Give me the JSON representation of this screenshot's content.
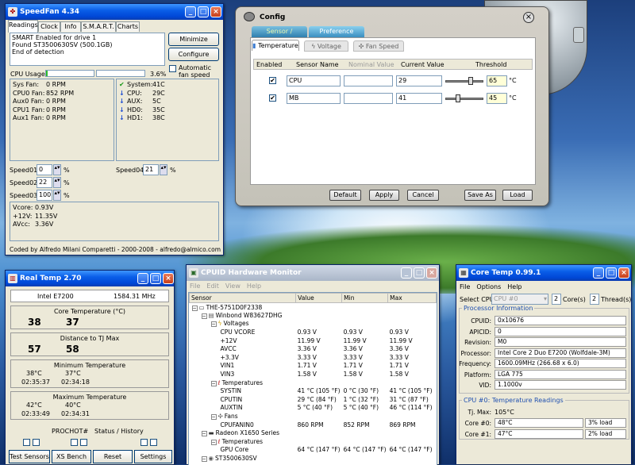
{
  "speedfan": {
    "title": "SpeedFan 4.34",
    "tabs": [
      "Readings",
      "Clock",
      "Info",
      "S.M.A.R.T.",
      "Charts"
    ],
    "log": [
      "SMART Enabled for drive 1",
      "Found ST3500630SV (500.1GB)",
      "End of detection"
    ],
    "minimize": "Minimize",
    "configure": "Configure",
    "cpu_usage_label": "CPU Usage",
    "cpu_usage_value": "3.6%",
    "cpu_usage_fraction": 0.036,
    "auto_fan": "Automatic fan speed",
    "fans": [
      {
        "label": "Sys Fan:",
        "value": "0 RPM"
      },
      {
        "label": "CPU0 Fan:",
        "value": "852 RPM"
      },
      {
        "label": "Aux0 Fan:",
        "value": "0 RPM"
      },
      {
        "label": "CPU1 Fan:",
        "value": "0 RPM"
      },
      {
        "label": "Aux1 Fan:",
        "value": "0 RPM"
      }
    ],
    "temps": [
      {
        "label": "System:",
        "value": "41C",
        "icon": "check"
      },
      {
        "label": "CPU:",
        "value": "29C",
        "icon": "down"
      },
      {
        "label": "AUX:",
        "value": "5C",
        "icon": "down"
      },
      {
        "label": "HD0:",
        "value": "35C",
        "icon": "down"
      },
      {
        "label": "HD1:",
        "value": "38C",
        "icon": "down"
      }
    ],
    "speeds": [
      {
        "label": "Speed01:",
        "value": "0",
        "unit": "%"
      },
      {
        "label": "Speed02:",
        "value": "22",
        "unit": "%"
      },
      {
        "label": "Speed03:",
        "value": "100",
        "unit": "%"
      },
      {
        "label": "Speed04:",
        "value": "21",
        "unit": "%"
      }
    ],
    "volts": [
      {
        "label": "Vcore:",
        "value": "0.93V"
      },
      {
        "label": "+12V:",
        "value": "11.35V"
      },
      {
        "label": "AVcc:",
        "value": "3.36V"
      }
    ],
    "footer": "Coded by Alfredo Milani Comparetti - 2000-2008 - alfredo@almico.com"
  },
  "config": {
    "title": "Config",
    "tabs": [
      "Sensor / Threshold",
      "Preference"
    ],
    "subtabs": [
      "Temperature",
      "Voltage",
      "Fan Speed"
    ],
    "headers": [
      "Enabled",
      "Sensor Name",
      "Nominal Value",
      "Current Value",
      "Threshold"
    ],
    "rows": [
      {
        "name": "CPU",
        "current": "29",
        "threshold": "65",
        "unit": "°C",
        "level": 0.65
      },
      {
        "name": "MB",
        "current": "41",
        "threshold": "45",
        "unit": "°C",
        "level": 0.3
      }
    ],
    "buttons": [
      "Default",
      "Apply",
      "Cancel",
      "Save As",
      "Load"
    ]
  },
  "realtemp": {
    "title": "Real Temp 2.70",
    "cpu": "Intel E7200",
    "freq": "1584.31 MHz",
    "core_temp_label": "Core Temperature (°C)",
    "core_temps": [
      "38",
      "37"
    ],
    "tj_label": "Distance to TJ Max",
    "tj": [
      "57",
      "58"
    ],
    "min_label": "Minimum Temperature",
    "min": [
      {
        "t": "38°C",
        "time": "02:35:37"
      },
      {
        "t": "37°C",
        "time": "02:34:18"
      }
    ],
    "max_label": "Maximum Temperature",
    "max": [
      {
        "t": "42°C",
        "time": "02:33:49"
      },
      {
        "t": "40°C",
        "time": "02:34:31"
      }
    ],
    "prochot": "PROCHOT#",
    "status": "Status / History",
    "buttons": [
      "Test Sensors",
      "XS Bench",
      "Reset",
      "Settings"
    ]
  },
  "hwmon": {
    "title": "CPUID Hardware Monitor",
    "menu": [
      "File",
      "Edit",
      "View",
      "Help"
    ],
    "columns": [
      "Sensor",
      "Value",
      "Min",
      "Max"
    ],
    "rows": [
      {
        "indent": 0,
        "name": "THE-5751D0F2338",
        "icon": "computer-icon",
        "v": "",
        "mn": "",
        "mx": ""
      },
      {
        "indent": 1,
        "name": "Winbond W83627DHG",
        "icon": "chip-icon",
        "v": "",
        "mn": "",
        "mx": ""
      },
      {
        "indent": 2,
        "name": "Voltages",
        "icon": "volt-icon",
        "v": "",
        "mn": "",
        "mx": ""
      },
      {
        "indent": 3,
        "name": "CPU VCORE",
        "v": "0.93 V",
        "mn": "0.93 V",
        "mx": "0.93 V"
      },
      {
        "indent": 3,
        "name": "+12V",
        "v": "11.99 V",
        "mn": "11.99 V",
        "mx": "11.99 V"
      },
      {
        "indent": 3,
        "name": "AVCC",
        "v": "3.36 V",
        "mn": "3.36 V",
        "mx": "3.36 V"
      },
      {
        "indent": 3,
        "name": "+3.3V",
        "v": "3.33 V",
        "mn": "3.33 V",
        "mx": "3.33 V"
      },
      {
        "indent": 3,
        "name": "VIN1",
        "v": "1.71 V",
        "mn": "1.71 V",
        "mx": "1.71 V"
      },
      {
        "indent": 3,
        "name": "VIN3",
        "v": "1.58 V",
        "mn": "1.58 V",
        "mx": "1.58 V"
      },
      {
        "indent": 2,
        "name": "Temperatures",
        "icon": "thermo-icon",
        "v": "",
        "mn": "",
        "mx": ""
      },
      {
        "indent": 3,
        "name": "SYSTIN",
        "v": "41 °C (105 °F)",
        "mn": "0 °C (30 °F)",
        "mx": "41 °C (105 °F)"
      },
      {
        "indent": 3,
        "name": "CPUTIN",
        "v": "29 °C (84 °F)",
        "mn": "1 °C (32 °F)",
        "mx": "31 °C (87 °F)"
      },
      {
        "indent": 3,
        "name": "AUXTIN",
        "v": "5 °C (40 °F)",
        "mn": "5 °C (40 °F)",
        "mx": "46 °C (114 °F)"
      },
      {
        "indent": 2,
        "name": "Fans",
        "icon": "fan-icon",
        "v": "",
        "mn": "",
        "mx": ""
      },
      {
        "indent": 3,
        "name": "CPUFANIN0",
        "v": "860 RPM",
        "mn": "852 RPM",
        "mx": "869 RPM"
      },
      {
        "indent": 1,
        "name": "Radeon X1650 Series",
        "icon": "gpu-icon",
        "v": "",
        "mn": "",
        "mx": ""
      },
      {
        "indent": 2,
        "name": "Temperatures",
        "icon": "thermo-icon",
        "v": "",
        "mn": "",
        "mx": ""
      },
      {
        "indent": 3,
        "name": "GPU Core",
        "v": "64 °C (147 °F)",
        "mn": "64 °C (147 °F)",
        "mx": "64 °C (147 °F)"
      },
      {
        "indent": 1,
        "name": "ST3500630SV",
        "icon": "disk-icon",
        "v": "",
        "mn": "",
        "mx": ""
      }
    ]
  },
  "coretemp": {
    "title": "Core Temp 0.99.1",
    "menu": [
      "File",
      "Options",
      "Help"
    ],
    "select_cpu": "Select CPU:",
    "cpu_sel": "CPU #0",
    "cores": "2",
    "cores_label": "Core(s)",
    "threads": "2",
    "threads_label": "Thread(s)",
    "proc_info": "Processor Information",
    "info": [
      {
        "label": "CPUID:",
        "value": "0x10676"
      },
      {
        "label": "APICID:",
        "value": "0"
      },
      {
        "label": "Revision:",
        "value": "M0"
      },
      {
        "label": "Processor:",
        "value": "Intel Core 2 Duo E7200 (Wolfdale-3M)"
      },
      {
        "label": "Frequency:",
        "value": "1600.09MHz (266.68 x 6.0)"
      },
      {
        "label": "Platform:",
        "value": "LGA 775"
      },
      {
        "label": "VID:",
        "value": "1.1000v"
      }
    ],
    "temp_head": "CPU #0: Temperature Readings",
    "tjmax_label": "Tj. Max:",
    "tjmax": "105°C",
    "cores_t": [
      {
        "label": "Core #0:",
        "t": "48°C",
        "load": "3% load"
      },
      {
        "label": "Core #1:",
        "t": "47°C",
        "load": "2% load"
      }
    ]
  }
}
